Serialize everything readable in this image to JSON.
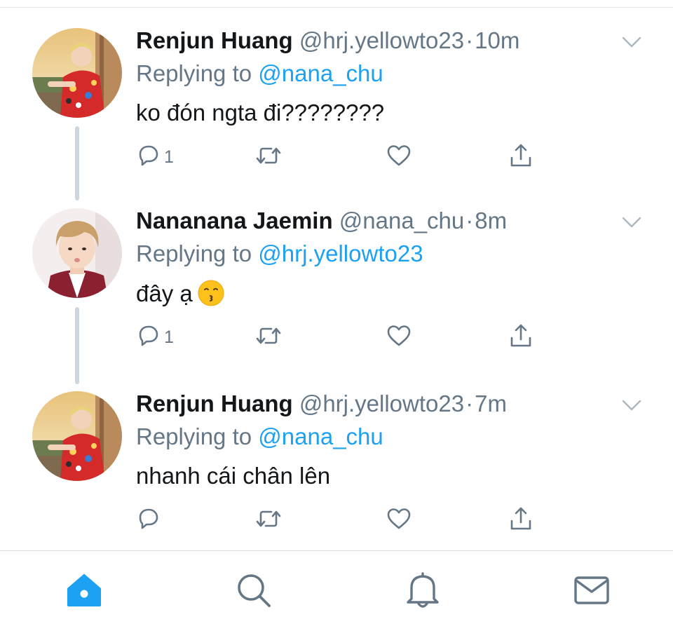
{
  "colors": {
    "accent": "#1da1f2",
    "secondary_text": "#657786",
    "primary_text": "#14171a",
    "thread_line": "#ccd6dd"
  },
  "tweets": [
    {
      "name": "Renjun Huang",
      "handle": "@hrj.yellowto23",
      "separator": "·",
      "time": "10m",
      "replying_prefix": "Replying to",
      "replying_to": "@nana_chu",
      "text": "ko đón ngta đi????????",
      "reply_count": "1",
      "avatar": "avatar-renjun",
      "icons": [
        "reply-icon",
        "retweet-icon",
        "like-icon",
        "share-icon",
        "chevron-down-icon"
      ]
    },
    {
      "name": "Nananana Jaemin",
      "handle": "@nana_chu",
      "separator": "·",
      "time": "8m",
      "replying_prefix": "Replying to",
      "replying_to": "@hrj.yellowto23",
      "text": "đây ạ",
      "emoji": "kissing-face-emoji",
      "reply_count": "1",
      "avatar": "avatar-jaemin",
      "icons": [
        "reply-icon",
        "retweet-icon",
        "like-icon",
        "share-icon",
        "chevron-down-icon"
      ]
    },
    {
      "name": "Renjun Huang",
      "handle": "@hrj.yellowto23",
      "separator": "·",
      "time": "7m",
      "replying_prefix": "Replying to",
      "replying_to": "@nana_chu",
      "text": "nhanh cái chân lên",
      "reply_count": "",
      "avatar": "avatar-renjun",
      "icons": [
        "reply-icon",
        "retweet-icon",
        "like-icon",
        "share-icon",
        "chevron-down-icon"
      ]
    }
  ],
  "bottom_nav": {
    "items": [
      "home-icon",
      "search-icon",
      "notifications-icon",
      "messages-icon"
    ],
    "active": "home-icon"
  }
}
